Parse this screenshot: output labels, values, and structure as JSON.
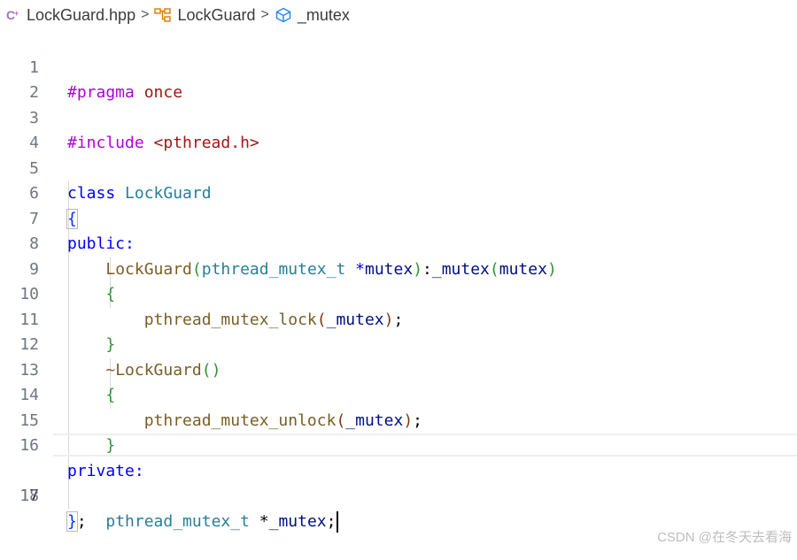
{
  "breadcrumb": {
    "file": "LockGuard.hpp",
    "class": "LockGuard",
    "member": "_mutex",
    "separator": ">"
  },
  "line_numbers": [
    "1",
    "2",
    "3",
    "4",
    "5",
    "6",
    "7",
    "8",
    "9",
    "10",
    "11",
    "12",
    "13",
    "14",
    "15",
    "16",
    "17",
    "18"
  ],
  "code": {
    "l1": {
      "a": "#pragma",
      "b": " once"
    },
    "l3": {
      "a": "#include",
      "b": " <pthread.h>"
    },
    "l5": {
      "a": "class",
      "b": " LockGuard"
    },
    "l6": {
      "a": "{"
    },
    "l7": {
      "a": "public:"
    },
    "l8": {
      "indent": "    ",
      "fn": "LockGuard",
      "p1": "(",
      "type": "pthread_mutex_t",
      "sp": " ",
      "star": "*",
      "arg": "mutex",
      "p2": ")",
      "colon": ":",
      "member": "_mutex",
      "p3": "(",
      "arg2": "mutex",
      "p4": ")"
    },
    "l9": {
      "indent": "    ",
      "a": "{"
    },
    "l10": {
      "indent": "        ",
      "fn": "pthread_mutex_lock",
      "p1": "(",
      "arg": "_mutex",
      "p2": ")",
      "semi": ";"
    },
    "l11": {
      "indent": "    ",
      "a": "}"
    },
    "l12": {
      "indent": "    ",
      "fn": "~LockGuard",
      "p": "()"
    },
    "l13": {
      "indent": "    ",
      "a": "{"
    },
    "l14": {
      "indent": "        ",
      "fn": "pthread_mutex_unlock",
      "p1": "(",
      "arg": "_mutex",
      "p2": ")",
      "semi": ";"
    },
    "l15": {
      "indent": "    ",
      "a": "}"
    },
    "l16": {
      "a": "private:"
    },
    "l17": {
      "indent": "    ",
      "type": "pthread_mutex_t",
      "rest": " *",
      "member": "_mutex",
      "semi": ";"
    },
    "l18": {
      "a": "}",
      "semi": ";"
    }
  },
  "colors": {
    "keyword": "#0000ff",
    "preprocessor": "#af00db",
    "string": "#a31515",
    "type": "#267f99",
    "function": "#795e26",
    "variable": "#001080"
  },
  "current_line": 17,
  "watermark": "CSDN @在冬天去看海"
}
